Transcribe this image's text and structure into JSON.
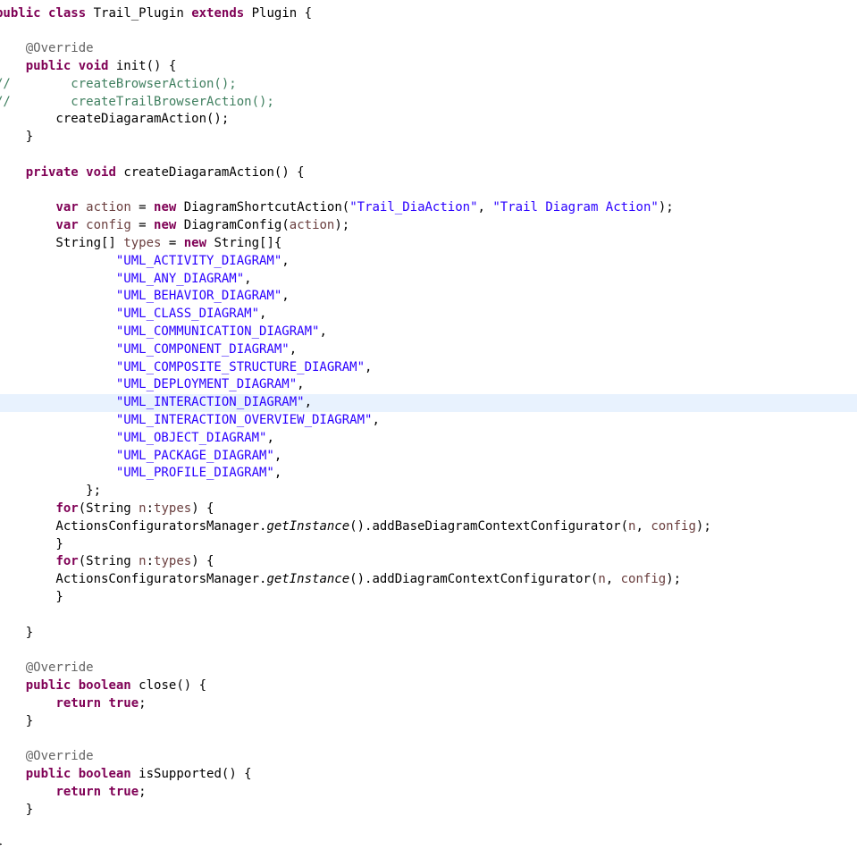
{
  "editor": {
    "current_line_index": 22,
    "colors": {
      "keyword": "#7f0055",
      "string": "#2a00ff",
      "comment": "#3f7f5f",
      "annotation": "#646464",
      "variable": "#6a3e3e",
      "plain": "#000000",
      "current_line_highlight": "#e8f2fe",
      "background": "#ffffff"
    },
    "lines": [
      [
        [
          "k",
          "public"
        ],
        [
          "p",
          " "
        ],
        [
          "k",
          "class"
        ],
        [
          "p",
          " Trail_Plugin "
        ],
        [
          "k",
          "extends"
        ],
        [
          "p",
          " Plugin {"
        ]
      ],
      [],
      [
        [
          "p",
          "    "
        ],
        [
          "a",
          "@Override"
        ]
      ],
      [
        [
          "p",
          "    "
        ],
        [
          "k",
          "public"
        ],
        [
          "p",
          " "
        ],
        [
          "k",
          "void"
        ],
        [
          "p",
          " init() {"
        ]
      ],
      [
        [
          "c",
          "//        createBrowserAction();"
        ]
      ],
      [
        [
          "c",
          "//        createTrailBrowserAction();"
        ]
      ],
      [
        [
          "p",
          "        createDiagaramAction();"
        ]
      ],
      [
        [
          "p",
          "    }"
        ]
      ],
      [],
      [
        [
          "p",
          "    "
        ],
        [
          "k",
          "private"
        ],
        [
          "p",
          " "
        ],
        [
          "k",
          "void"
        ],
        [
          "p",
          " createDiagaramAction() {"
        ]
      ],
      [],
      [
        [
          "p",
          "        "
        ],
        [
          "k",
          "var"
        ],
        [
          "p",
          " "
        ],
        [
          "v",
          "action"
        ],
        [
          "p",
          " = "
        ],
        [
          "k",
          "new"
        ],
        [
          "p",
          " DiagramShortcutAction("
        ],
        [
          "s",
          "\"Trail_DiaAction\""
        ],
        [
          "p",
          ", "
        ],
        [
          "s",
          "\"Trail Diagram Action\""
        ],
        [
          "p",
          ");"
        ]
      ],
      [
        [
          "p",
          "        "
        ],
        [
          "k",
          "var"
        ],
        [
          "p",
          " "
        ],
        [
          "v",
          "config"
        ],
        [
          "p",
          " = "
        ],
        [
          "k",
          "new"
        ],
        [
          "p",
          " DiagramConfig("
        ],
        [
          "v",
          "action"
        ],
        [
          "p",
          ");"
        ]
      ],
      [
        [
          "p",
          "        String[] "
        ],
        [
          "v",
          "types"
        ],
        [
          "p",
          " = "
        ],
        [
          "k",
          "new"
        ],
        [
          "p",
          " String[]{"
        ]
      ],
      [
        [
          "p",
          "                "
        ],
        [
          "s",
          "\"UML_ACTIVITY_DIAGRAM\""
        ],
        [
          "p",
          ","
        ]
      ],
      [
        [
          "p",
          "                "
        ],
        [
          "s",
          "\"UML_ANY_DIAGRAM\""
        ],
        [
          "p",
          ","
        ]
      ],
      [
        [
          "p",
          "                "
        ],
        [
          "s",
          "\"UML_BEHAVIOR_DIAGRAM\""
        ],
        [
          "p",
          ","
        ]
      ],
      [
        [
          "p",
          "                "
        ],
        [
          "s",
          "\"UML_CLASS_DIAGRAM\""
        ],
        [
          "p",
          ","
        ]
      ],
      [
        [
          "p",
          "                "
        ],
        [
          "s",
          "\"UML_COMMUNICATION_DIAGRAM\""
        ],
        [
          "p",
          ","
        ]
      ],
      [
        [
          "p",
          "                "
        ],
        [
          "s",
          "\"UML_COMPONENT_DIAGRAM\""
        ],
        [
          "p",
          ","
        ]
      ],
      [
        [
          "p",
          "                "
        ],
        [
          "s",
          "\"UML_COMPOSITE_STRUCTURE_DIAGRAM\""
        ],
        [
          "p",
          ","
        ]
      ],
      [
        [
          "p",
          "                "
        ],
        [
          "s",
          "\"UML_DEPLOYMENT_DIAGRAM\""
        ],
        [
          "p",
          ","
        ]
      ],
      [
        [
          "p",
          "                "
        ],
        [
          "s",
          "\"UML_INTERACTION_DIAGRAM\""
        ],
        [
          "p",
          ","
        ]
      ],
      [
        [
          "p",
          "                "
        ],
        [
          "s",
          "\"UML_INTERACTION_OVERVIEW_DIAGRAM\""
        ],
        [
          "p",
          ","
        ]
      ],
      [
        [
          "p",
          "                "
        ],
        [
          "s",
          "\"UML_OBJECT_DIAGRAM\""
        ],
        [
          "p",
          ","
        ]
      ],
      [
        [
          "p",
          "                "
        ],
        [
          "s",
          "\"UML_PACKAGE_DIAGRAM\""
        ],
        [
          "p",
          ","
        ]
      ],
      [
        [
          "p",
          "                "
        ],
        [
          "s",
          "\"UML_PROFILE_DIAGRAM\""
        ],
        [
          "p",
          ","
        ]
      ],
      [
        [
          "p",
          "            };"
        ]
      ],
      [
        [
          "p",
          "        "
        ],
        [
          "k",
          "for"
        ],
        [
          "p",
          "(String "
        ],
        [
          "v",
          "n"
        ],
        [
          "p",
          ":"
        ],
        [
          "v",
          "types"
        ],
        [
          "p",
          ") {"
        ]
      ],
      [
        [
          "p",
          "        ActionsConfiguratorsManager."
        ],
        [
          "i",
          "getInstance"
        ],
        [
          "p",
          "().addBaseDiagramContextConfigurator("
        ],
        [
          "v",
          "n"
        ],
        [
          "p",
          ", "
        ],
        [
          "v",
          "config"
        ],
        [
          "p",
          ");"
        ]
      ],
      [
        [
          "p",
          "        }"
        ]
      ],
      [
        [
          "p",
          "        "
        ],
        [
          "k",
          "for"
        ],
        [
          "p",
          "(String "
        ],
        [
          "v",
          "n"
        ],
        [
          "p",
          ":"
        ],
        [
          "v",
          "types"
        ],
        [
          "p",
          ") {"
        ]
      ],
      [
        [
          "p",
          "        ActionsConfiguratorsManager."
        ],
        [
          "i",
          "getInstance"
        ],
        [
          "p",
          "().addDiagramContextConfigurator("
        ],
        [
          "v",
          "n"
        ],
        [
          "p",
          ", "
        ],
        [
          "v",
          "config"
        ],
        [
          "p",
          ");"
        ]
      ],
      [
        [
          "p",
          "        }"
        ]
      ],
      [],
      [
        [
          "p",
          "    }"
        ]
      ],
      [],
      [
        [
          "p",
          "    "
        ],
        [
          "a",
          "@Override"
        ]
      ],
      [
        [
          "p",
          "    "
        ],
        [
          "k",
          "public"
        ],
        [
          "p",
          " "
        ],
        [
          "k",
          "boolean"
        ],
        [
          "p",
          " close() {"
        ]
      ],
      [
        [
          "p",
          "        "
        ],
        [
          "k",
          "return"
        ],
        [
          "p",
          " "
        ],
        [
          "k",
          "true"
        ],
        [
          "p",
          ";"
        ]
      ],
      [
        [
          "p",
          "    }"
        ]
      ],
      [],
      [
        [
          "p",
          "    "
        ],
        [
          "a",
          "@Override"
        ]
      ],
      [
        [
          "p",
          "    "
        ],
        [
          "k",
          "public"
        ],
        [
          "p",
          " "
        ],
        [
          "k",
          "boolean"
        ],
        [
          "p",
          " isSupported() {"
        ]
      ],
      [
        [
          "p",
          "        "
        ],
        [
          "k",
          "return"
        ],
        [
          "p",
          " "
        ],
        [
          "k",
          "true"
        ],
        [
          "p",
          ";"
        ]
      ],
      [
        [
          "p",
          "    }"
        ]
      ],
      [],
      [
        [
          "p",
          "}"
        ]
      ]
    ]
  }
}
